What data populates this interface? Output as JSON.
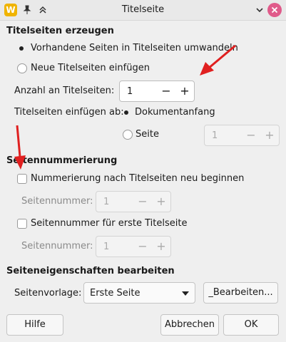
{
  "window": {
    "title": "Titelseite",
    "app_icon_letter": "W",
    "icons": [
      "pin-icon",
      "chevrons-up-icon",
      "chevron-down-icon",
      "close-icon"
    ]
  },
  "section_create": {
    "title": "Titelseiten erzeugen",
    "radio_convert": "Vorhandene Seiten in Titelseiten umwandeln",
    "radio_insert": "Neue Titelseiten einfügen",
    "count_label": "Anzahl an Titelseiten:",
    "count_value": "1",
    "insert_at_label": "Titelseiten einfügen ab:",
    "radio_doc_start": "Dokumentanfang",
    "radio_page": "Seite",
    "page_value": "1"
  },
  "section_numbering": {
    "title": "Seitennummerierung",
    "check_restart": "Nummerierung nach Titelseiten neu beginnen",
    "page_number_label_1": "Seitennummer:",
    "page_number_value_1": "1",
    "check_first_title": "Seitennummer für erste Titelseite",
    "page_number_label_2": "Seitennummer:",
    "page_number_value_2": "1"
  },
  "section_props": {
    "title": "Seiteneigenschaften bearbeiten",
    "style_label": "Seitenvorlage:",
    "style_value": "Erste Seite",
    "edit_button": "_Bearbeiten..."
  },
  "buttons": {
    "help": "Hilfe",
    "cancel": "Abbrechen",
    "ok": "OK"
  },
  "spin": {
    "minus": "−",
    "plus": "+"
  },
  "colors": {
    "accent_close": "#e05a8a",
    "annotation_arrow": "#e02020",
    "app_icon": "#f0b400"
  }
}
